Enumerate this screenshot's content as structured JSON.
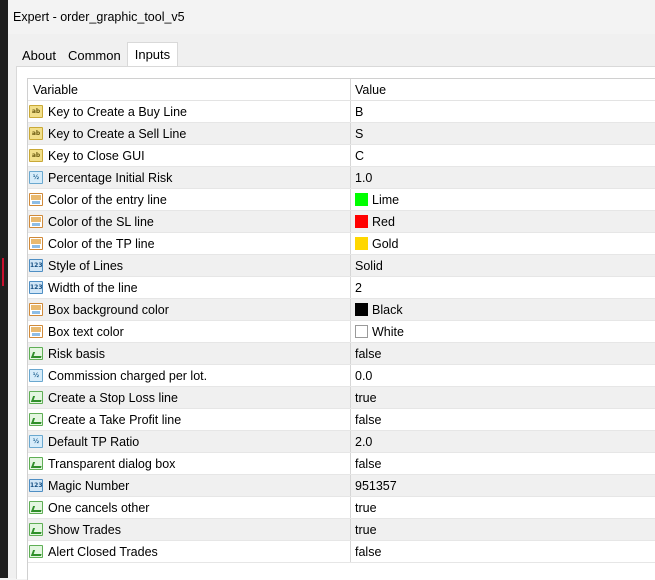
{
  "window": {
    "title": "Expert - order_graphic_tool_v5"
  },
  "tabs": [
    {
      "label": "About",
      "active": false
    },
    {
      "label": "Common",
      "active": false
    },
    {
      "label": "Inputs",
      "active": true
    }
  ],
  "table": {
    "headers": {
      "variable": "Variable",
      "value": "Value"
    },
    "rows": [
      {
        "icon": "string-icon",
        "variable": "Key to Create a Buy Line",
        "value": "B"
      },
      {
        "icon": "string-icon",
        "variable": "Key to Create a Sell Line",
        "value": "S"
      },
      {
        "icon": "string-icon",
        "variable": "Key to Close GUI",
        "value": "C"
      },
      {
        "icon": "double-icon",
        "variable": "Percentage Initial Risk",
        "value": "1.0"
      },
      {
        "icon": "color-icon",
        "variable": "Color of the entry line",
        "value": "Lime",
        "swatch": "#00ff00"
      },
      {
        "icon": "color-icon",
        "variable": "Color of the SL line",
        "value": "Red",
        "swatch": "#ff0000"
      },
      {
        "icon": "color-icon",
        "variable": "Color of the TP line",
        "value": "Gold",
        "swatch": "#ffd700"
      },
      {
        "icon": "integer-icon",
        "variable": "Style of Lines",
        "value": "Solid"
      },
      {
        "icon": "integer-icon",
        "variable": "Width of the line",
        "value": "2"
      },
      {
        "icon": "color-icon",
        "variable": "Box background color",
        "value": "Black",
        "swatch": "#000000"
      },
      {
        "icon": "color-icon",
        "variable": "Box text color",
        "value": "White",
        "swatch": "#ffffff"
      },
      {
        "icon": "bool-icon",
        "variable": "Risk basis",
        "value": "false"
      },
      {
        "icon": "double-icon",
        "variable": "Commission charged per lot.",
        "value": "0.0"
      },
      {
        "icon": "bool-icon",
        "variable": "Create a Stop Loss line",
        "value": "true"
      },
      {
        "icon": "bool-icon",
        "variable": "Create a Take Profit line",
        "value": "false"
      },
      {
        "icon": "double-icon",
        "variable": "Default TP Ratio",
        "value": "2.0"
      },
      {
        "icon": "bool-icon",
        "variable": "Transparent dialog box",
        "value": "false"
      },
      {
        "icon": "integer-icon",
        "variable": "Magic Number",
        "value": "951357"
      },
      {
        "icon": "bool-icon",
        "variable": "One cancels other",
        "value": "true"
      },
      {
        "icon": "bool-icon",
        "variable": "Show Trades",
        "value": "true"
      },
      {
        "icon": "bool-icon",
        "variable": "Alert Closed Trades",
        "value": "false"
      }
    ]
  },
  "icon_glyphs": {
    "string-icon": "ab",
    "double-icon": "½",
    "integer-icon": "123"
  }
}
